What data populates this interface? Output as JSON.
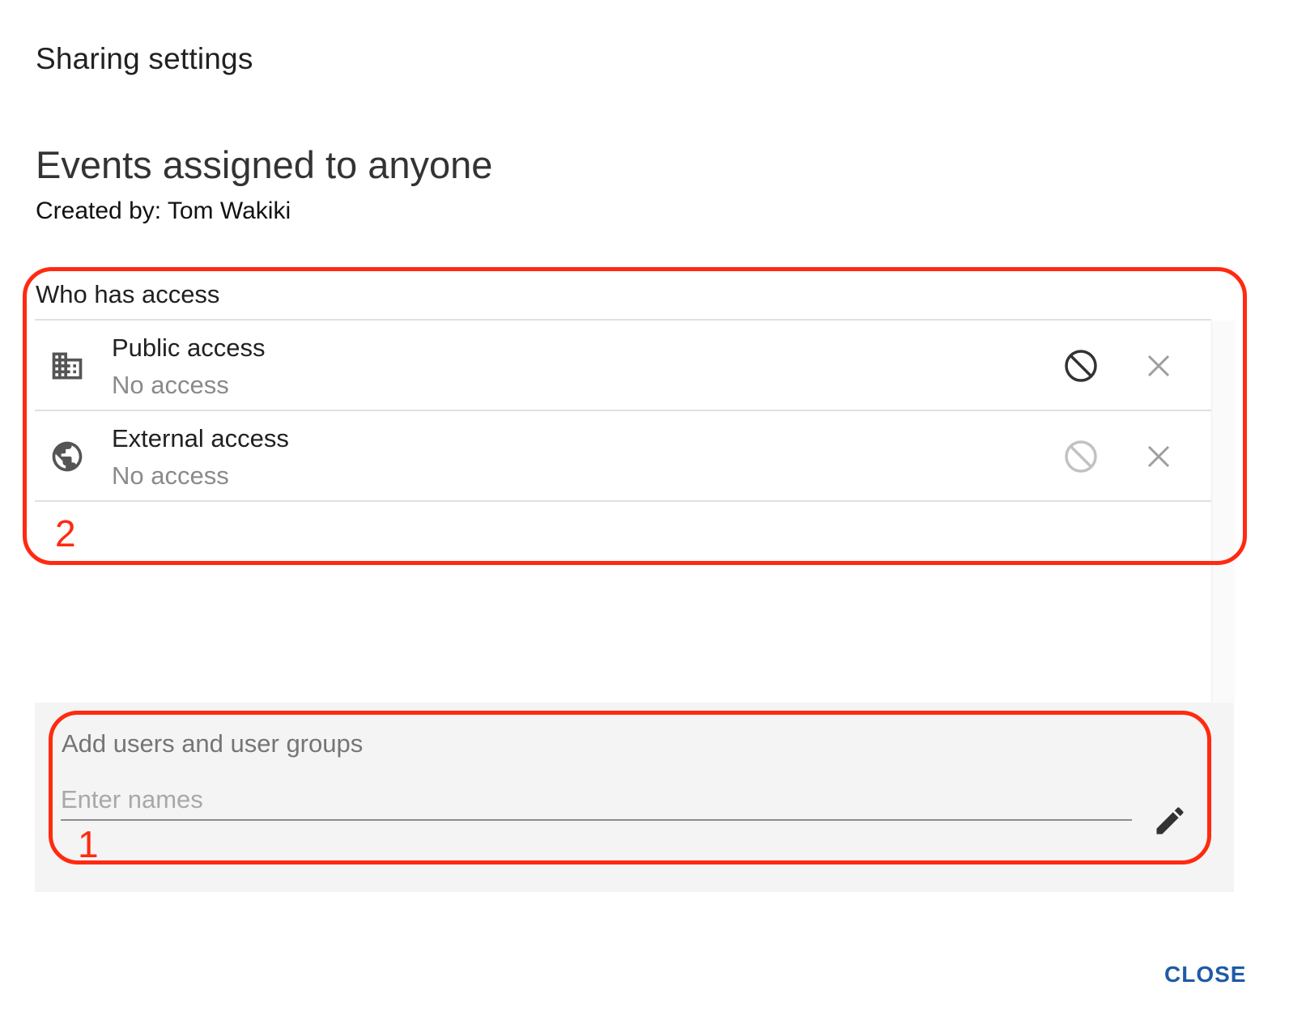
{
  "dialog": {
    "title": "Sharing settings",
    "object_name": "Events assigned to anyone",
    "created_by": "Created by: Tom Wakiki"
  },
  "access": {
    "section_label": "Who has access",
    "rows": [
      {
        "name": "Public access",
        "level": "No access",
        "icon": "building-icon",
        "noaccess_active": true
      },
      {
        "name": "External access",
        "level": "No access",
        "icon": "globe-icon",
        "noaccess_active": false
      }
    ]
  },
  "add_users": {
    "title": "Add users and user groups",
    "placeholder": "Enter names",
    "value": ""
  },
  "footer": {
    "close_label": "CLOSE"
  },
  "annotations": {
    "label_1": "1",
    "label_2": "2",
    "color": "#ff2a10"
  },
  "colors": {
    "accent": "#1f5aa6",
    "annotation": "#ff2a10",
    "panel_bg": "#f4f4f4"
  }
}
